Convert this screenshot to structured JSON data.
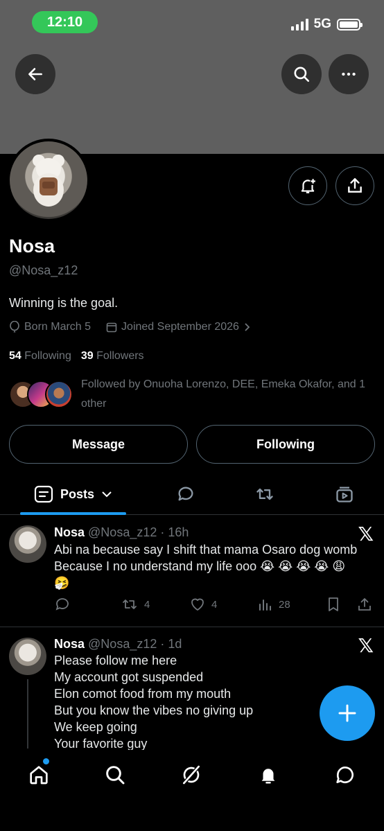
{
  "status_bar": {
    "time": "12:10",
    "network": "5G"
  },
  "profile": {
    "name": "Nosa",
    "handle": "@Nosa_z12",
    "bio": "Winning is the goal.",
    "born": "Born March 5",
    "joined": "Joined September 2026",
    "following_count": "54",
    "following_label": "Following",
    "followers_count": "39",
    "followers_label": "Followers",
    "followed_by": "Followed by Onuoha Lorenzo, DEE, Emeka Okafor, and 1 other",
    "message_button": "Message",
    "following_button": "Following"
  },
  "tabs": {
    "posts": "Posts"
  },
  "posts": [
    {
      "name": "Nosa",
      "handle_time": "@Nosa_z12 · 16h",
      "lines": [
        "Abi na because say I shift that mama Osaro dog womb",
        "Because I no understand my life ooo 😭 😭 😭 😭 😩",
        "🤧"
      ],
      "retweets": "4",
      "likes": "4",
      "views": "28"
    },
    {
      "name": "Nosa",
      "handle_time": "@Nosa_z12 · 1d",
      "lines": [
        "Please follow me here",
        "My account got suspended",
        "Elon comot food from my mouth",
        "But you know the vibes no giving up",
        "We keep going",
        "Your favorite guy"
      ]
    }
  ],
  "colors": {
    "accent": "#1d9bf0",
    "status_green": "#34c759",
    "banner": "#5f5f5f"
  }
}
